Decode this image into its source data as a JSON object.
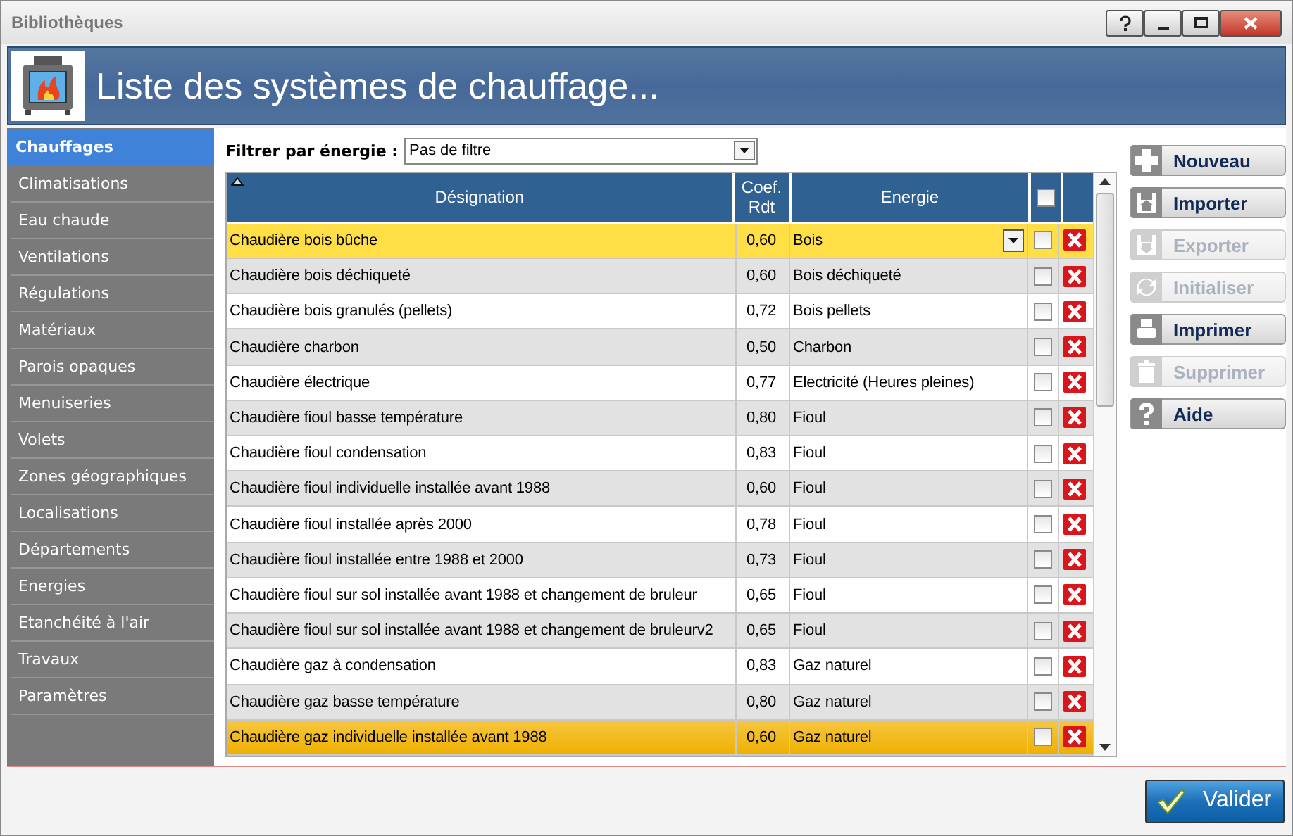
{
  "window": {
    "title": "Bibliothèques",
    "controls": [
      {
        "kind": "help"
      },
      {
        "kind": "minimize"
      },
      {
        "kind": "maximize"
      },
      {
        "kind": "close"
      }
    ]
  },
  "header": {
    "title": "Liste des systèmes de chauffage..."
  },
  "sidebar": {
    "items": [
      {
        "label": "Chauffages",
        "selected": true
      },
      {
        "label": "Climatisations",
        "selected": false
      },
      {
        "label": "Eau chaude",
        "selected": false
      },
      {
        "label": "Ventilations",
        "selected": false
      },
      {
        "label": "Régulations",
        "selected": false
      },
      {
        "label": "Matériaux",
        "selected": false
      },
      {
        "label": "Parois opaques",
        "selected": false
      },
      {
        "label": "Menuiseries",
        "selected": false
      },
      {
        "label": "Volets",
        "selected": false
      },
      {
        "label": "Zones géographiques",
        "selected": false
      },
      {
        "label": "Localisations",
        "selected": false
      },
      {
        "label": "Départements",
        "selected": false
      },
      {
        "label": "Energies",
        "selected": false
      },
      {
        "label": "Etanchéité à l'air",
        "selected": false
      },
      {
        "label": "Travaux",
        "selected": false
      },
      {
        "label": "Paramètres",
        "selected": false
      }
    ]
  },
  "filter": {
    "label": "Filtrer par énergie :",
    "value": "Pas de filtre"
  },
  "table": {
    "columns": [
      "Désignation",
      "Coef. Rdt",
      "Energie"
    ],
    "select_all_checked": false,
    "rows": [
      {
        "designation": "Chaudière bois bûche",
        "coef": "0,60",
        "energie": "Bois",
        "checked": false,
        "selected": true,
        "hovered": false,
        "editing": true
      },
      {
        "designation": "Chaudière bois déchiqueté",
        "coef": "0,60",
        "energie": "Bois déchiqueté",
        "checked": false,
        "selected": false,
        "hovered": false,
        "editing": false
      },
      {
        "designation": "Chaudière bois granulés (pellets)",
        "coef": "0,72",
        "energie": "Bois pellets",
        "checked": false,
        "selected": false,
        "hovered": false,
        "editing": false
      },
      {
        "designation": "Chaudière charbon",
        "coef": "0,50",
        "energie": "Charbon",
        "checked": false,
        "selected": false,
        "hovered": false,
        "editing": false
      },
      {
        "designation": "Chaudière électrique",
        "coef": "0,77",
        "energie": "Electricité (Heures pleines)",
        "checked": false,
        "selected": false,
        "hovered": false,
        "editing": false
      },
      {
        "designation": "Chaudière fioul basse température",
        "coef": "0,80",
        "energie": "Fioul",
        "checked": false,
        "selected": false,
        "hovered": false,
        "editing": false
      },
      {
        "designation": "Chaudière fioul condensation",
        "coef": "0,83",
        "energie": "Fioul",
        "checked": false,
        "selected": false,
        "hovered": false,
        "editing": false
      },
      {
        "designation": "Chaudière fioul individuelle installée avant 1988",
        "coef": "0,60",
        "energie": "Fioul",
        "checked": false,
        "selected": false,
        "hovered": false,
        "editing": false
      },
      {
        "designation": "Chaudière fioul installée après 2000",
        "coef": "0,78",
        "energie": "Fioul",
        "checked": false,
        "selected": false,
        "hovered": false,
        "editing": false
      },
      {
        "designation": "Chaudière fioul installée entre 1988 et 2000",
        "coef": "0,73",
        "energie": "Fioul",
        "checked": false,
        "selected": false,
        "hovered": false,
        "editing": false
      },
      {
        "designation": "Chaudière fioul sur sol installée avant 1988 et changement de bruleur",
        "coef": "0,65",
        "energie": "Fioul",
        "checked": false,
        "selected": false,
        "hovered": false,
        "editing": false
      },
      {
        "designation": "Chaudière fioul sur sol installée avant 1988 et changement de bruleurv2",
        "coef": "0,65",
        "energie": "Fioul",
        "checked": false,
        "selected": false,
        "hovered": false,
        "editing": false
      },
      {
        "designation": "Chaudière gaz à condensation",
        "coef": "0,83",
        "energie": "Gaz naturel",
        "checked": false,
        "selected": false,
        "hovered": false,
        "editing": false
      },
      {
        "designation": "Chaudière gaz basse température",
        "coef": "0,80",
        "energie": "Gaz naturel",
        "checked": false,
        "selected": false,
        "hovered": false,
        "editing": false
      },
      {
        "designation": "Chaudière gaz individuelle installée avant 1988",
        "coef": "0,60",
        "energie": "Gaz naturel",
        "checked": false,
        "selected": false,
        "hovered": true,
        "editing": false
      }
    ]
  },
  "actions": [
    {
      "label": "Nouveau",
      "kind": "plus",
      "disabled": false
    },
    {
      "label": "Importer",
      "kind": "import",
      "disabled": false
    },
    {
      "label": "Exporter",
      "kind": "export",
      "disabled": true
    },
    {
      "label": "Initialiser",
      "kind": "refresh",
      "disabled": true
    },
    {
      "label": "Imprimer",
      "kind": "print",
      "disabled": false
    },
    {
      "label": "Supprimer",
      "kind": "trash",
      "disabled": true
    },
    {
      "label": "Aide",
      "kind": "help",
      "disabled": false
    }
  ],
  "footer": {
    "button": "Valider"
  }
}
